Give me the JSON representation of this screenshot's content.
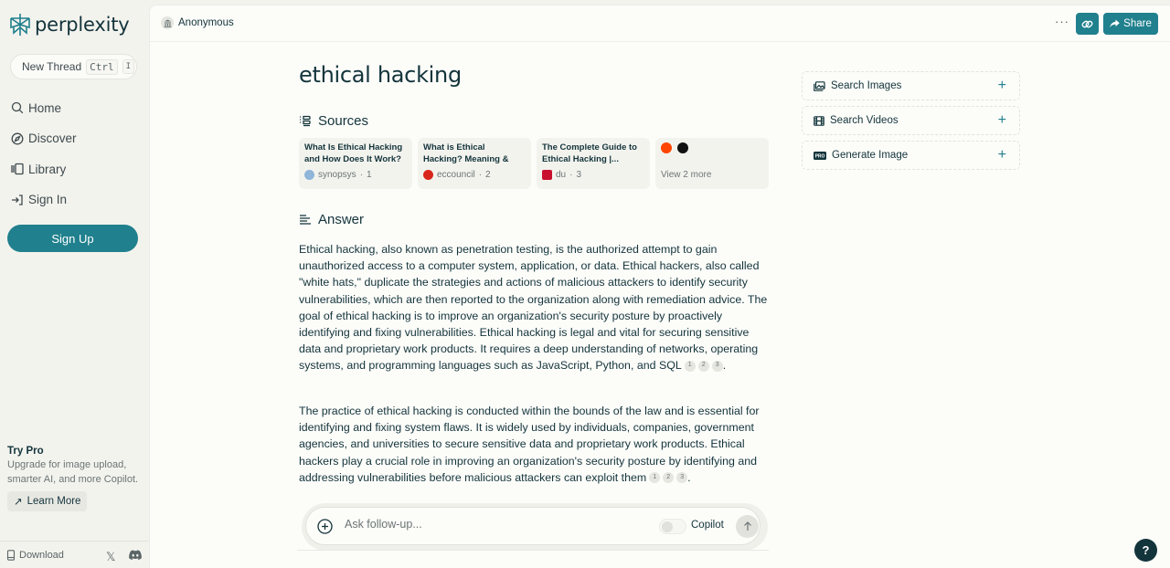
{
  "brand": {
    "name": "perplexity",
    "accent": "#20808d",
    "dark": "#13343b"
  },
  "sidebar": {
    "new_thread": {
      "label": "New Thread",
      "shortcut_key1": "Ctrl",
      "shortcut_key2": "I"
    },
    "nav": [
      {
        "label": "Home",
        "icon": "search-icon"
      },
      {
        "label": "Discover",
        "icon": "compass-icon"
      },
      {
        "label": "Library",
        "icon": "library-icon"
      },
      {
        "label": "Sign In",
        "icon": "sign-in-icon"
      }
    ],
    "signup_label": "Sign Up",
    "try_pro": {
      "title": "Try Pro",
      "description": "Upgrade for image upload, smarter AI, and more Copilot.",
      "learn_more": "Learn More"
    },
    "footer": {
      "download_label": "Download",
      "x_icon": "x-icon",
      "discord_icon": "discord-icon"
    }
  },
  "topbar": {
    "user": "Anonymous",
    "more": "···",
    "share_label": "Share"
  },
  "query": {
    "title": "ethical hacking"
  },
  "sources": {
    "heading": "Sources",
    "items": [
      {
        "title": "What Is Ethical Hacking and How Does It Work? ...",
        "site": "synopsys",
        "index": "1",
        "favicon_color": "#8fb5d9"
      },
      {
        "title": "What is Ethical Hacking? Meaning & Types of...",
        "site": "eccouncil",
        "index": "2",
        "favicon_color": "#d9261c"
      },
      {
        "title": "The Complete Guide to Ethical Hacking |...",
        "site": "du",
        "index": "3",
        "favicon_color": "#c8102e"
      }
    ],
    "more": {
      "label": "View 2 more",
      "favicons": [
        "#ff4500",
        "#111111"
      ]
    }
  },
  "answer": {
    "heading": "Answer",
    "paragraphs": [
      {
        "text": "Ethical hacking, also known as penetration testing, is the authorized attempt to gain unauthorized access to a computer system, application, or data. Ethical hackers, also called \"white hats,\" duplicate the strategies and actions of malicious attackers to identify security vulnerabilities, which are then reported to the organization along with remediation advice. The goal of ethical hacking is to improve an organization's security posture by proactively identifying and fixing vulnerabilities. Ethical hacking is legal and vital for securing sensitive data and proprietary work products. It requires a deep understanding of networks, operating systems, and programming languages such as JavaScript, Python, and SQL",
        "citations": [
          "1",
          "2",
          "3"
        ]
      },
      {
        "text": "The practice of ethical hacking is conducted within the bounds of the law and is essential for identifying and fixing system flaws. It is widely used by individuals, companies, government agencies, and universities to secure sensitive data and proprietary work products. Ethical hackers play a crucial role in improving an organization's security posture by identifying and addressing vulnerabilities before malicious attackers can exploit them",
        "citations": [
          "1",
          "2",
          "3"
        ]
      }
    ]
  },
  "followup": {
    "placeholder": "Ask follow-up...",
    "copilot_label": "Copilot",
    "copilot_enabled": false
  },
  "right_panel": {
    "items": [
      {
        "label": "Search Images",
        "icon": "image-icon"
      },
      {
        "label": "Search Videos",
        "icon": "film-icon"
      },
      {
        "label": "Generate Image",
        "icon": "pro-badge-icon"
      }
    ]
  },
  "help": {
    "label": "?"
  }
}
